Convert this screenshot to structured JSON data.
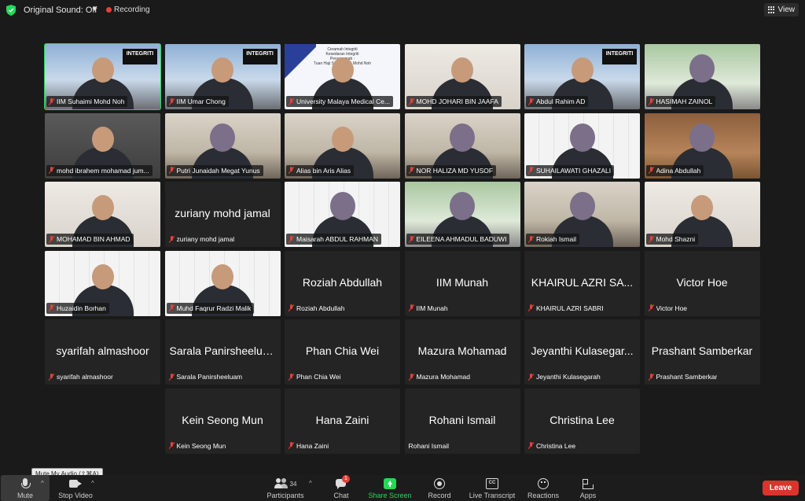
{
  "topbar": {
    "original_sound": "Original Sound: Off",
    "recording": "Recording",
    "view": "View"
  },
  "tiles": [
    {
      "name": "IIM Suhaimi Mohd Noh",
      "video": "city",
      "active": true,
      "badge": "INTEGRITI"
    },
    {
      "name": "IIM Umar Chong",
      "video": "city",
      "badge": "INTEGRITI"
    },
    {
      "name": "University Malaya Medical Ce...",
      "video": "slide",
      "slide_text": "Ceramah Integriti\nKesedaran Integriti\nPenceramah :\nTuan Haji Suhaimi bin Mohd Noh"
    },
    {
      "name": "MOHD JOHARI BIN JAAFA",
      "video": "wall"
    },
    {
      "name": "Abdul Rahim AD",
      "video": "city",
      "badge": "INTEGRITI"
    },
    {
      "name": "HASIMAH ZAINOL",
      "video": "green",
      "hijab": true
    },
    {
      "name": "mohd ibrahem mohamad jum...",
      "video": "dark"
    },
    {
      "name": "Putri Junaidah Megat Yunus",
      "video": "office",
      "hijab": true
    },
    {
      "name": "Alias bin Aris Alias",
      "video": "office"
    },
    {
      "name": "NOR HALIZA MD YUSOF",
      "video": "office",
      "hijab": true
    },
    {
      "name": "SUHAILAWATI GHAZALI",
      "video": "logo",
      "hijab": true
    },
    {
      "name": "Adina Abdullah",
      "video": "wood",
      "hijab": true
    },
    {
      "name": "MOHAMAD BIN AHMAD",
      "video": "wall"
    },
    {
      "name": "zuriany mohd jamal",
      "video": "none"
    },
    {
      "name": "Maisarah ABDUL RAHMAN",
      "video": "logo",
      "hijab": true
    },
    {
      "name": "EILEENA AHMADUL BADUWI",
      "video": "green",
      "hijab": true
    },
    {
      "name": "Rokiah Ismail",
      "video": "office",
      "hijab": true
    },
    {
      "name": "Mohd Shazni",
      "video": "wall"
    },
    {
      "name": "Huzaidin Borhan",
      "video": "logo"
    },
    {
      "name": "Muhd Faqrur Radzi Malik",
      "video": "logo"
    },
    {
      "name": "Roziah Abdullah",
      "video": "none"
    },
    {
      "name": "IIM Munah",
      "video": "none"
    },
    {
      "name": "KHAIRUL AZRI SABRI",
      "video": "none",
      "display": "KHAIRUL AZRI SA..."
    },
    {
      "name": "Victor Hoe",
      "video": "none"
    },
    {
      "name": "syarifah almashoor",
      "video": "none"
    },
    {
      "name": "Sarala Panirsheeluam",
      "video": "none"
    },
    {
      "name": "Phan Chia Wei",
      "video": "none"
    },
    {
      "name": "Mazura Mohamad",
      "video": "none"
    },
    {
      "name": "Jeyanthi Kulasegarah",
      "video": "none",
      "display": "Jeyanthi Kulasegar..."
    },
    {
      "name": "Prashant Samberkar",
      "video": "none"
    },
    {
      "name": "Kein Seong Mun",
      "video": "none"
    },
    {
      "name": "Hana Zaini",
      "video": "none"
    },
    {
      "name": "Rohani Ismail",
      "video": "none",
      "no_mic_icon": true
    },
    {
      "name": "Christina Lee",
      "video": "none"
    }
  ],
  "toolbar": {
    "mute": "Mute",
    "mute_tooltip": "Mute My Audio (⇧⌘A)",
    "stop_video": "Stop Video",
    "participants": "Participants",
    "participants_count": "34",
    "chat": "Chat",
    "chat_badge": "1",
    "share_screen": "Share Screen",
    "record": "Record",
    "live_transcript": "Live Transcript",
    "reactions": "Reactions",
    "apps": "Apps",
    "leave": "Leave"
  },
  "colors": {
    "active_speaker": "#23d959",
    "muted": "#e8403a",
    "leave": "#d9352d",
    "share": "#23d959"
  }
}
